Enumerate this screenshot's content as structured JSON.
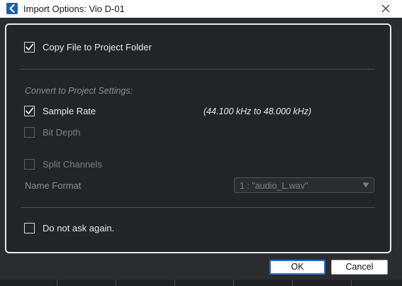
{
  "window": {
    "title": "Import Options: Vio D-01",
    "app_icon": "cubase-icon",
    "close_icon": "close-icon"
  },
  "options": {
    "copy_file": {
      "label": "Copy File to Project Folder",
      "checked": true,
      "enabled": true
    },
    "section_heading": "Convert to Project Settings:",
    "sample_rate": {
      "label": "Sample Rate",
      "checked": true,
      "enabled": true,
      "info": "(44.100 kHz to 48.000 kHz)"
    },
    "bit_depth": {
      "label": "Bit Depth",
      "checked": false,
      "enabled": false
    },
    "split_channels": {
      "label": "Split Channels",
      "checked": false,
      "enabled": false
    },
    "name_format": {
      "label": "Name Format",
      "value": "1 : \"audio_L.wav\"",
      "enabled": false
    },
    "do_not_ask": {
      "label": "Do not ask again.",
      "checked": false,
      "enabled": true
    }
  },
  "buttons": {
    "ok_label": "OK",
    "cancel_label": "Cancel"
  },
  "colors": {
    "accent": "#2f6ed4",
    "panel_border": "#e7e9ec",
    "background": "#2a2c30"
  }
}
